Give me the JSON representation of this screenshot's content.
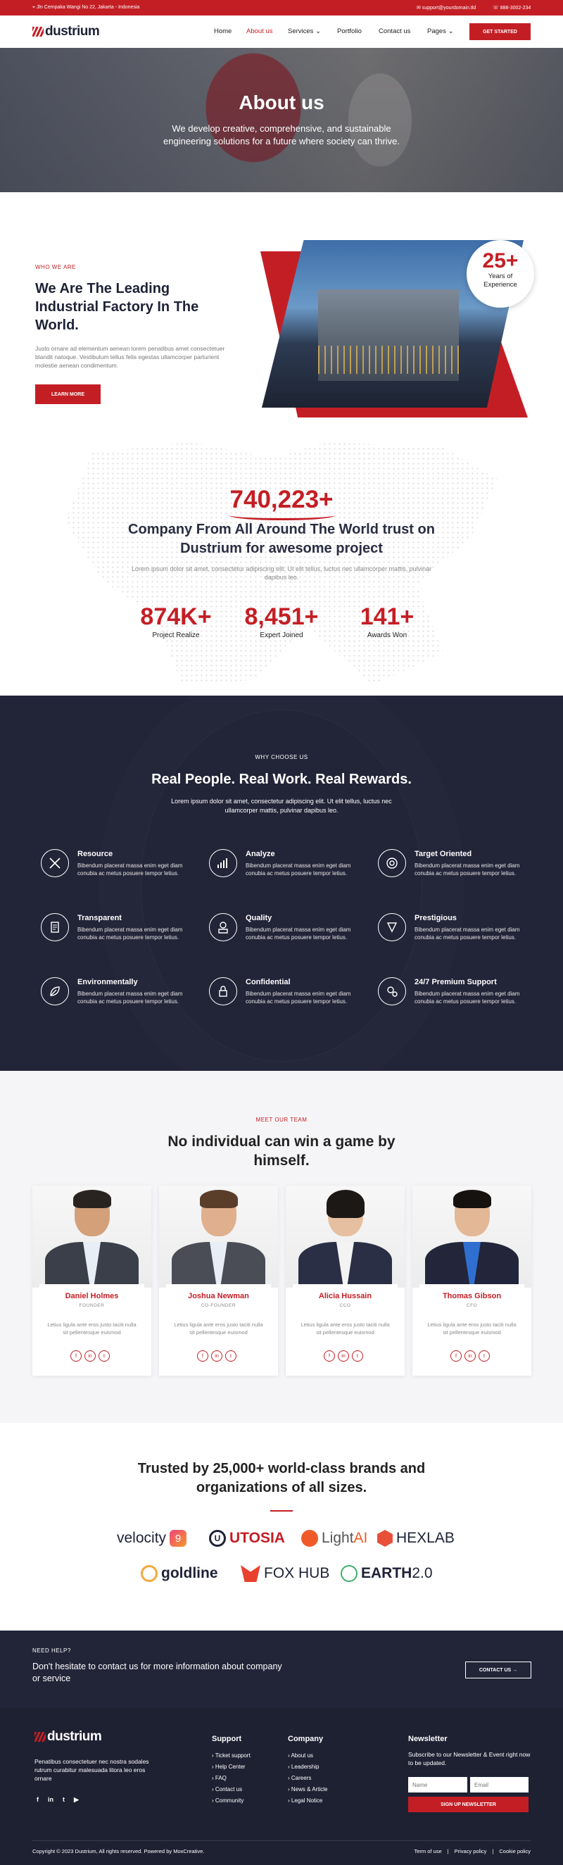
{
  "topbar": {
    "address": "Jln Cempaka Wangi No 22, Jakarta - Indonesia",
    "email": "support@yourdomain.tld",
    "phone": "888-3002-234"
  },
  "nav": {
    "logo": "dustrium",
    "items": [
      {
        "label": "Home"
      },
      {
        "label": "About us"
      },
      {
        "label": "Services"
      },
      {
        "label": "Portfolio"
      },
      {
        "label": "Contact us"
      },
      {
        "label": "Pages"
      }
    ],
    "cta": "GET STARTED"
  },
  "hero": {
    "title": "About us",
    "subtitle": "We develop creative, comprehensive, and sustainable engineering solutions for a future where society can thrive."
  },
  "about": {
    "eyebrow": "WHO WE ARE",
    "title": "We Are The Leading Industrial Factory In The World.",
    "body": "Justo ornare ad elementum aenean lorem penatibus amet consectetuer blandit natoque. Vestibulum tellus felis egestas ullamcorper parturient molestie aenean condimentum.",
    "button": "LEARN MORE",
    "badge_number": "25+",
    "badge_text": "Years of Experience"
  },
  "stats": {
    "big": "740,223+",
    "title": "Company From All Around The World trust on Dustrium for awesome project",
    "body": "Lorem ipsum dolor sit amet, consectetur adipiscing elit. Ut elit tellus, luctus nec ullamcorper mattis, pulvinar dapibus leo.",
    "items": [
      {
        "value": "874K+",
        "label": "Project Realize"
      },
      {
        "value": "8,451+",
        "label": "Expert Joined"
      },
      {
        "value": "141+",
        "label": "Awards Won"
      }
    ]
  },
  "why": {
    "eyebrow": "WHY CHOOSE US",
    "title": "Real People. Real Work. Real Rewards.",
    "subtitle": "Lorem ipsum dolor sit amet, consectetur adipiscing elit. Ut elit tellus, luctus nec ullamcorper mattis, pulvinar dapibus leo.",
    "features": [
      {
        "title": "Resource",
        "text": "Bibendum placerat massa enim eget diam conubia ac metus posuere tempor letius.",
        "icon": "tools-icon"
      },
      {
        "title": "Analyze",
        "text": "Bibendum placerat massa enim eget diam conubia ac metus posuere tempor letius.",
        "icon": "chart-icon"
      },
      {
        "title": "Target Oriented",
        "text": "Bibendum placerat massa enim eget diam conubia ac metus posuere tempor letius.",
        "icon": "target-icon"
      },
      {
        "title": "Transparent",
        "text": "Bibendum placerat massa enim eget diam conubia ac metus posuere tempor letius.",
        "icon": "document-icon"
      },
      {
        "title": "Quality",
        "text": "Bibendum placerat massa enim eget diam conubia ac metus posuere tempor letius.",
        "icon": "medal-icon"
      },
      {
        "title": "Prestigious",
        "text": "Bibendum placerat massa enim eget diam conubia ac metus posuere tempor letius.",
        "icon": "trophy-icon"
      },
      {
        "title": "Environmentally",
        "text": "Bibendum placerat massa enim eget diam conubia ac metus posuere tempor letius.",
        "icon": "leaf-icon"
      },
      {
        "title": "Confidential",
        "text": "Bibendum placerat massa enim eget diam conubia ac metus posuere tempor letius.",
        "icon": "lock-icon"
      },
      {
        "title": "24/7 Premium Support",
        "text": "Bibendum placerat massa enim eget diam conubia ac metus posuere tempor letius.",
        "icon": "support-icon"
      }
    ]
  },
  "team": {
    "eyebrow": "MEET OUR TEAM",
    "title": "No individual can win a game by himself.",
    "members": [
      {
        "name": "Daniel Holmes",
        "role": "FOUNDER",
        "text": "Letius ligula ante eros justo taciti nulla sit pellentesque euismod"
      },
      {
        "name": "Joshua Newman",
        "role": "CO-FOUNDER",
        "text": "Letius ligula ante eros justo taciti nulla sit pellentesque euismod"
      },
      {
        "name": "Alicia Hussain",
        "role": "CCO",
        "text": "Letius ligula ante eros justo taciti nulla sit pellentesque euismod"
      },
      {
        "name": "Thomas Gibson",
        "role": "CFO",
        "text": "Letius ligula ante eros justo taciti nulla sit pellentesque euismod"
      }
    ],
    "social": [
      "f",
      "in",
      "t"
    ]
  },
  "brands": {
    "title": "Trusted by 25,000+ world-class brands and organizations of all sizes.",
    "logos": [
      {
        "name": "velocity",
        "suffix": "9"
      },
      {
        "name": "UTOSIA"
      },
      {
        "name": "Light",
        "suffix": "AI"
      },
      {
        "name": "HEXLAB"
      },
      {
        "name": "goldline"
      },
      {
        "name": "FOX HUB"
      },
      {
        "name": "EARTH",
        "suffix": "2.0"
      }
    ]
  },
  "help": {
    "eyebrow": "NEED HELP?",
    "text": "Don't hesitate to contact us for more information about company or service",
    "button": "CONTACT US  →"
  },
  "footer": {
    "logo": "dustrium",
    "description": "Penatibus consectetuer nec nostra sodales rutrum curabitur malesuada litora leo eros ornare",
    "social": [
      "f",
      "in",
      "t",
      "▶"
    ],
    "support": {
      "title": "Support",
      "links": [
        "Ticket support",
        "Help Center",
        "FAQ",
        "Contact us",
        "Community"
      ]
    },
    "company": {
      "title": "Company",
      "links": [
        "About us",
        "Leadership",
        "Careers",
        "News & Article",
        "Legal Notice"
      ]
    },
    "newsletter": {
      "title": "Newsletter",
      "text": "Subscribe to our Newsletter & Event right now to be updated.",
      "name_placeholder": "Name",
      "email_placeholder": "Email",
      "button": "SIGN UP NEWSLETTER"
    },
    "copyright": "Copyright © 2023 Dustrium, All rights reserved. Powered by MoxCreative.",
    "legal": [
      "Term of use",
      "|",
      "Privacy policy",
      "|",
      "Cookie policy"
    ]
  },
  "colors": {
    "accent": "#c41e25",
    "dark": "#222538",
    "footer": "#1e2132"
  }
}
